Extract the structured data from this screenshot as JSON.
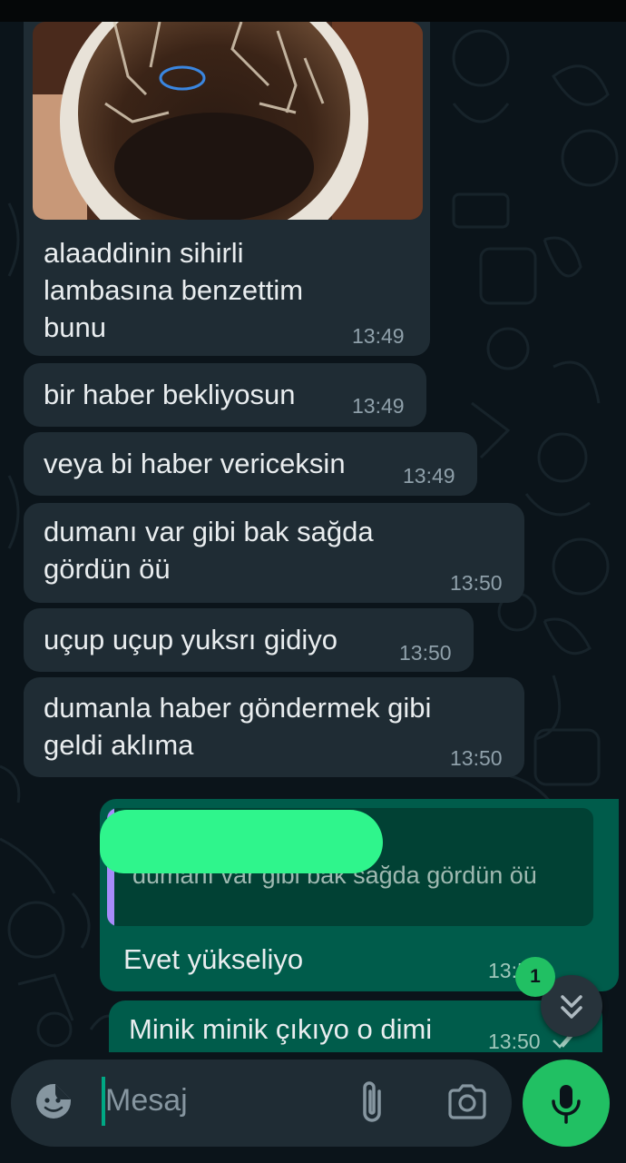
{
  "messages": [
    {
      "text": "alaaddinin sihirli lambasına benzettim bunu",
      "time": "13:49"
    },
    {
      "text": "bir haber bekliyosun",
      "time": "13:49"
    },
    {
      "text": "veya bi haber vericeksin",
      "time": "13:49"
    },
    {
      "text": "dumanı var gibi bak sağda gördün öü",
      "time": "13:50"
    },
    {
      "text": "uçup uçup yuksrı gidiyo",
      "time": "13:50"
    },
    {
      "text": "dumanla haber göndermek gibi geldi aklıma",
      "time": "13:50"
    }
  ],
  "outgoing": [
    {
      "quoted_text": "dumanı var gibi bak sağda gördün öü",
      "text": "Evet yükseliyo",
      "time": "13:50"
    },
    {
      "text": "Minik minik çıkıyo o dimi",
      "time": "13:50"
    }
  ],
  "unread_count": "1",
  "composer": {
    "placeholder": "Mesaj"
  },
  "icons": [
    "sticker-icon",
    "attach-icon",
    "camera-icon",
    "mic-icon",
    "double-chevron-down-icon",
    "read-receipt-icon"
  ],
  "colors": {
    "incoming": "#1f2c34",
    "outgoing": "#005c4b",
    "accent": "#21c063",
    "background": "#0b141a"
  }
}
